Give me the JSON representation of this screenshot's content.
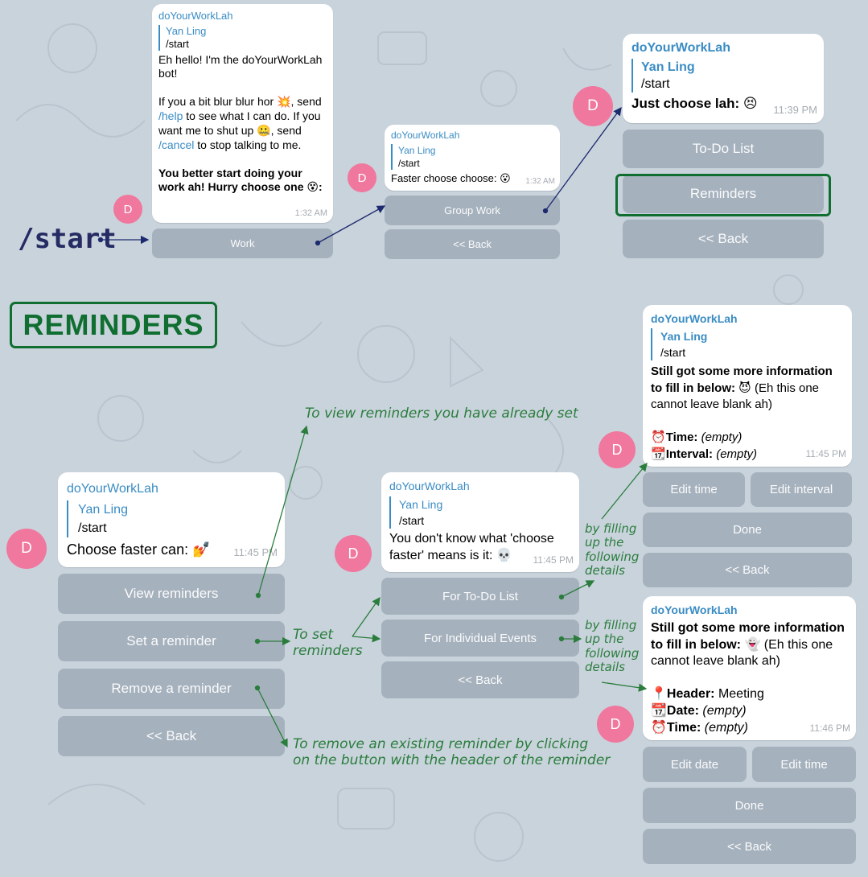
{
  "colors": {
    "background": "#c9d3dc",
    "bubble": "#ffffff",
    "button": "#a3afbb",
    "avatar": "#f0779d",
    "link": "#3a8cc4",
    "annotation": "#2a7d3c",
    "highlight": "#0f6e30"
  },
  "start_label": "/start",
  "reminders_label": "REMINDERS",
  "avatar_letter": "D",
  "bot_name": "doYourWorkLah",
  "reply_name": "Yan Ling",
  "reply_text": "/start",
  "back_label": "<< Back",
  "m1": {
    "line1": "Eh hello! I'm the doYourWorkLah bot!",
    "p2a": "If you a bit blur blur hor ",
    "e2a": "💥",
    "p2b": ", send ",
    "help": "/help",
    "p2c": " to see what I can do. If you want me to shut up ",
    "e2b": "🤐",
    "p2d": ", send ",
    "cancel": "/cancel",
    "p2e": " to stop talking to me.",
    "p3": "You better start doing your work ah! Hurry choose one ",
    "e3": "😵",
    "p3b": ":",
    "time": "1:32 AM",
    "button": "Work"
  },
  "m2": {
    "text": "Faster choose choose: ",
    "emoji": "😮",
    "time": "1:32 AM",
    "button1": "Group Work"
  },
  "m3": {
    "text": "Just choose lah: ",
    "emoji": "😣",
    "time": "11:39 PM",
    "button1": "To-Do List",
    "button2": "Reminders"
  },
  "m4": {
    "text": "Choose faster can: ",
    "emoji": "💅",
    "time": "11:45 PM",
    "button1": "View reminders",
    "button2": "Set a reminder",
    "button3": "Remove a reminder"
  },
  "m5": {
    "text": "You don't know what 'choose faster' means is it: ",
    "emoji": "💀",
    "time": "11:45 PM",
    "button1": "For To-Do List",
    "button2": "For Individual Events"
  },
  "m6": {
    "title": "Still got some more information to fill in below: ",
    "emoji": "😈",
    "rest": " (Eh this one cannot leave blank ah)",
    "time_icon": "⏰",
    "time_label": "Time:",
    "time_val": "(empty)",
    "interval_icon": "📆",
    "interval_label": "Interval:",
    "interval_val": "(empty)",
    "time": "11:45 PM",
    "btn_time": "Edit time",
    "btn_interval": "Edit interval",
    "btn_done": "Done"
  },
  "m7": {
    "title": "Still got some more information to fill in below: ",
    "emoji": "👻",
    "rest": " (Eh this one cannot leave blank ah)",
    "header_icon": "📍",
    "header_label": "Header:",
    "header_val": " Meeting",
    "date_icon": "📆",
    "date_label": "Date:",
    "date_val": "(empty)",
    "time_icon": "⏰",
    "time_label": "Time:",
    "time_val": "(empty)",
    "time": "11:46 PM",
    "btn_date": "Edit date",
    "btn_time": "Edit time",
    "btn_done": "Done"
  },
  "annotations": {
    "view": "To view reminders you have already set",
    "set1": "To set",
    "set2": "reminders",
    "fill1a": "by filling",
    "fill1b": "up the",
    "fill1c": "following",
    "fill1d": "details",
    "fill2a": "by filling",
    "fill2b": "up the",
    "fill2c": "following",
    "fill2d": "details",
    "remove1": "To remove an existing reminder by clicking",
    "remove2": "on the button with the header of the reminder"
  }
}
